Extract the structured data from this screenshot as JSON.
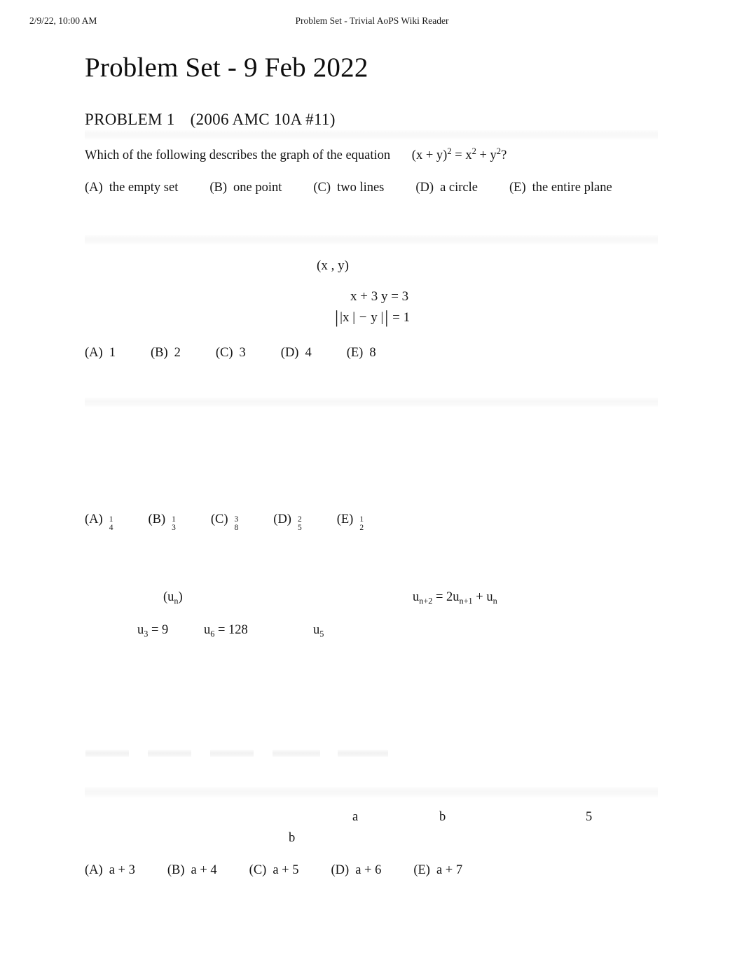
{
  "print_header": {
    "date": "2/9/22, 10:00 AM",
    "title": "Problem Set - Trivial AoPS Wiki Reader"
  },
  "document": {
    "page_title": "Problem Set - 9 Feb 2022"
  },
  "problem1": {
    "heading_number": "PROBLEM 1",
    "heading_source": "(2006 AMC 10A #11)",
    "statement_text": "Which of the following describes the graph of the equation",
    "statement_equation": {
      "lhs_open": "(x +",
      "lhs_var": "y)",
      "lhs_exp": "2",
      "eq": "=",
      "rhs_a": "x",
      "rhs_a_exp": "2",
      "plus": "+",
      "rhs_b": "y",
      "rhs_b_exp": "2",
      "question_mark": "?",
      "plain": "(x + y)2 = x2 + y2?"
    },
    "choices": [
      {
        "label": "(A)",
        "value": "the empty set"
      },
      {
        "label": "(B)",
        "value": "one point"
      },
      {
        "label": "(C)",
        "value": "two lines"
      },
      {
        "label": "(D)",
        "value": "a circle"
      },
      {
        "label": "(E)",
        "value": "the entire plane"
      }
    ]
  },
  "problem2": {
    "ordered_pair": "(x , y)",
    "equation_1": "x + 3 y = 3",
    "equation_2": {
      "outer_open": "|",
      "inner_x": "|x |",
      "minus": "−",
      "inner_y": "y |",
      "outer_close": "|",
      "rhs": "= 1",
      "plain": "||x| - |y|| = 1"
    },
    "choices": [
      {
        "label": "(A)",
        "value": "1"
      },
      {
        "label": "(B)",
        "value": "2"
      },
      {
        "label": "(C)",
        "value": "3"
      },
      {
        "label": "(D)",
        "value": "4"
      },
      {
        "label": "(E)",
        "value": "8"
      }
    ]
  },
  "problem3": {
    "choices": [
      {
        "label": "(A)",
        "num": "1",
        "den": "4"
      },
      {
        "label": "(B)",
        "num": "1",
        "den": "3"
      },
      {
        "label": "(C)",
        "num": "3",
        "den": "8"
      },
      {
        "label": "(D)",
        "num": "2",
        "den": "5"
      },
      {
        "label": "(E)",
        "num": "1",
        "den": "2"
      }
    ]
  },
  "problem4": {
    "sequence_name": {
      "base": "(u",
      "sub": "n",
      "close": ")"
    },
    "recurrence": {
      "lhs_base": "u",
      "lhs_sub": "n+2",
      "eq": "=",
      "coef": "2u",
      "rhs_sub": "n+1",
      "plus": "+",
      "tail_base": "u",
      "tail_sub": "n",
      "plain": "u(n+2) = 2u(n+1) + u(n)"
    },
    "given_1": {
      "base": "u",
      "sub": "3",
      "rest": "= 9"
    },
    "given_2": {
      "base": "u",
      "sub": "6",
      "rest": "= 128"
    },
    "target": {
      "base": "u",
      "sub": "5"
    }
  },
  "problem5": {
    "token_a": "a",
    "token_b": "b",
    "token_5": "5",
    "token_b2": "b",
    "choices": [
      {
        "label": "(A)",
        "value": "a + 3"
      },
      {
        "label": "(B)",
        "value": "a + 4"
      },
      {
        "label": "(C)",
        "value": "a + 5"
      },
      {
        "label": "(D)",
        "value": "a + 6"
      },
      {
        "label": "(E)",
        "value": "a + 7"
      }
    ]
  },
  "colors": {
    "page_background": "#ffffff",
    "text": "#141414",
    "ghost_placeholder": "#f6f6f6"
  }
}
